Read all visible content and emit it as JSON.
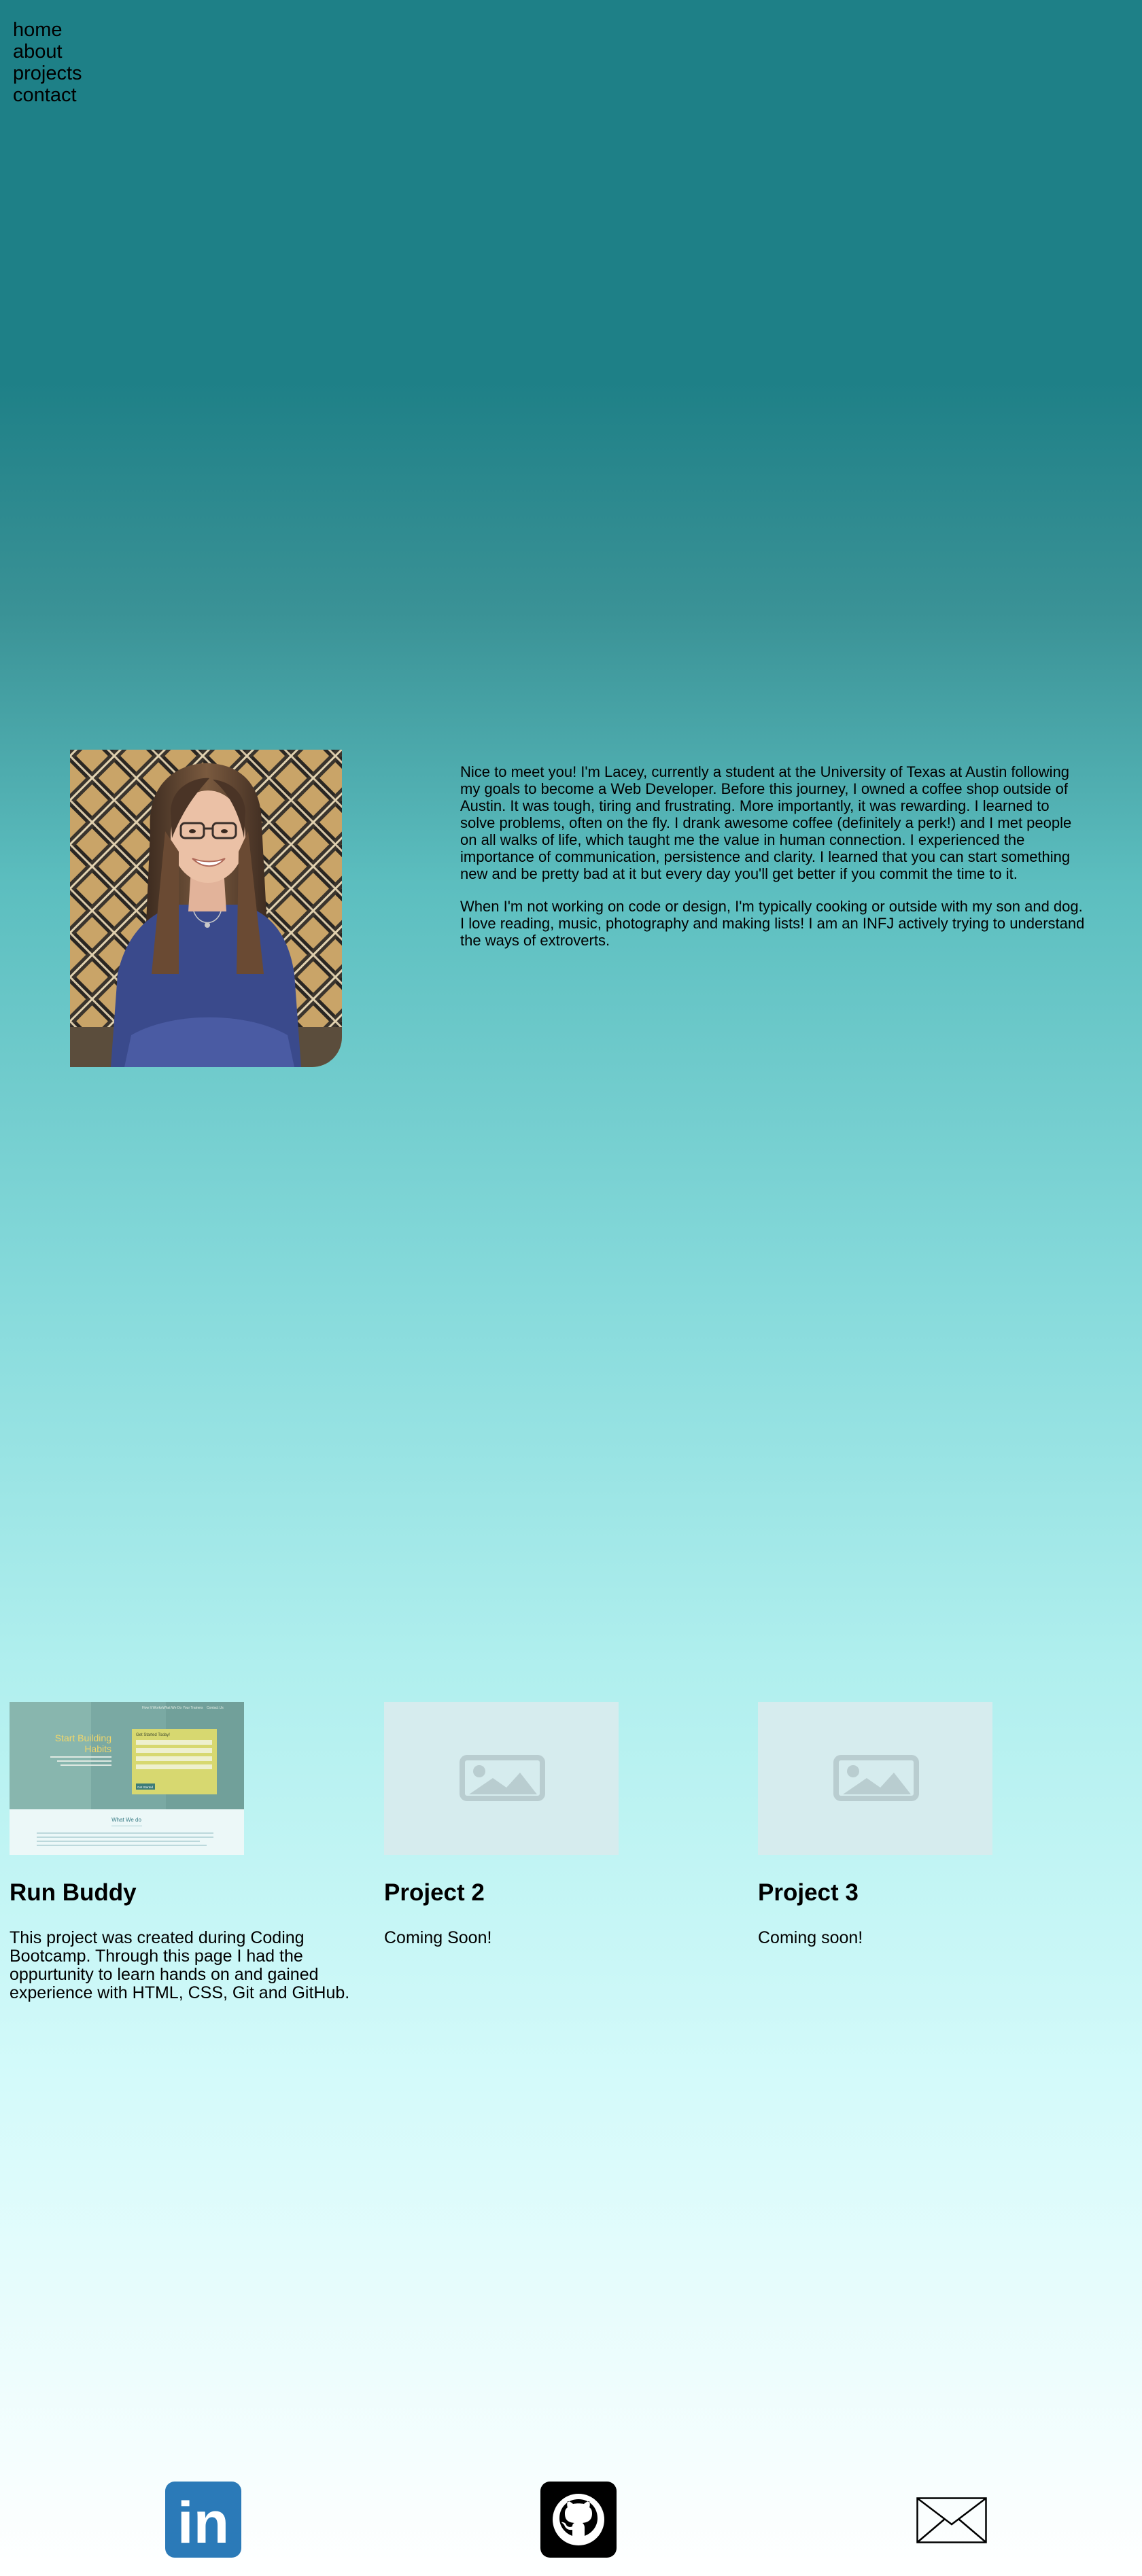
{
  "nav": {
    "items": [
      "home",
      "about",
      "projects",
      "contact"
    ]
  },
  "about": {
    "portrait_alt": "Lacey portrait",
    "paragraphs": [
      "Nice to meet you! I'm Lacey, currently a student at the University of Texas at Austin following my goals to become a Web Developer. Before this journey, I owned a coffee shop outside of Austin. It was tough, tiring and frustrating. More importantly, it was rewarding. I learned to solve problems, often on the fly. I drank awesome coffee (definitely a perk!) and I met people on all walks of life, which taught me the value in human connection. I experienced the importance of communication, persistence and clarity. I learned that you can start something new and be pretty bad at it but every day you'll get better if you commit the time to it.",
      "When I'm not working on code or design, I'm typically cooking or outside with my son and dog. I love reading, music, photography and making lists! I am an INFJ actively trying to understand the ways of extroverts."
    ]
  },
  "projects": [
    {
      "title": "Run Buddy",
      "description": "This project was created during Coding Bootcamp. Through this page I had the oppurtunity to learn hands on and gained experience with HTML, CSS, Git and GitHub.",
      "thumb_text": {
        "nav": [
          "How It Works",
          "What We Do",
          "Your Trainers",
          "Contact Us"
        ],
        "hero_title": [
          "Start Building",
          "Habits"
        ],
        "form_title": "Get Started Today!",
        "button": "Get Started",
        "section_title": "What We do"
      }
    },
    {
      "title": "Project 2",
      "description": "Coming Soon!"
    },
    {
      "title": "Project 3",
      "description": "Coming soon!"
    }
  ],
  "social": {
    "linkedin_glyph": "in",
    "icons": [
      "linkedin-icon",
      "github-icon",
      "mail-icon"
    ]
  },
  "colors": {
    "linkedin": "#2b7ab8",
    "github": "#000000",
    "placeholder_bg": "#d6ecee",
    "placeholder_icon": "#b9cdd0"
  }
}
